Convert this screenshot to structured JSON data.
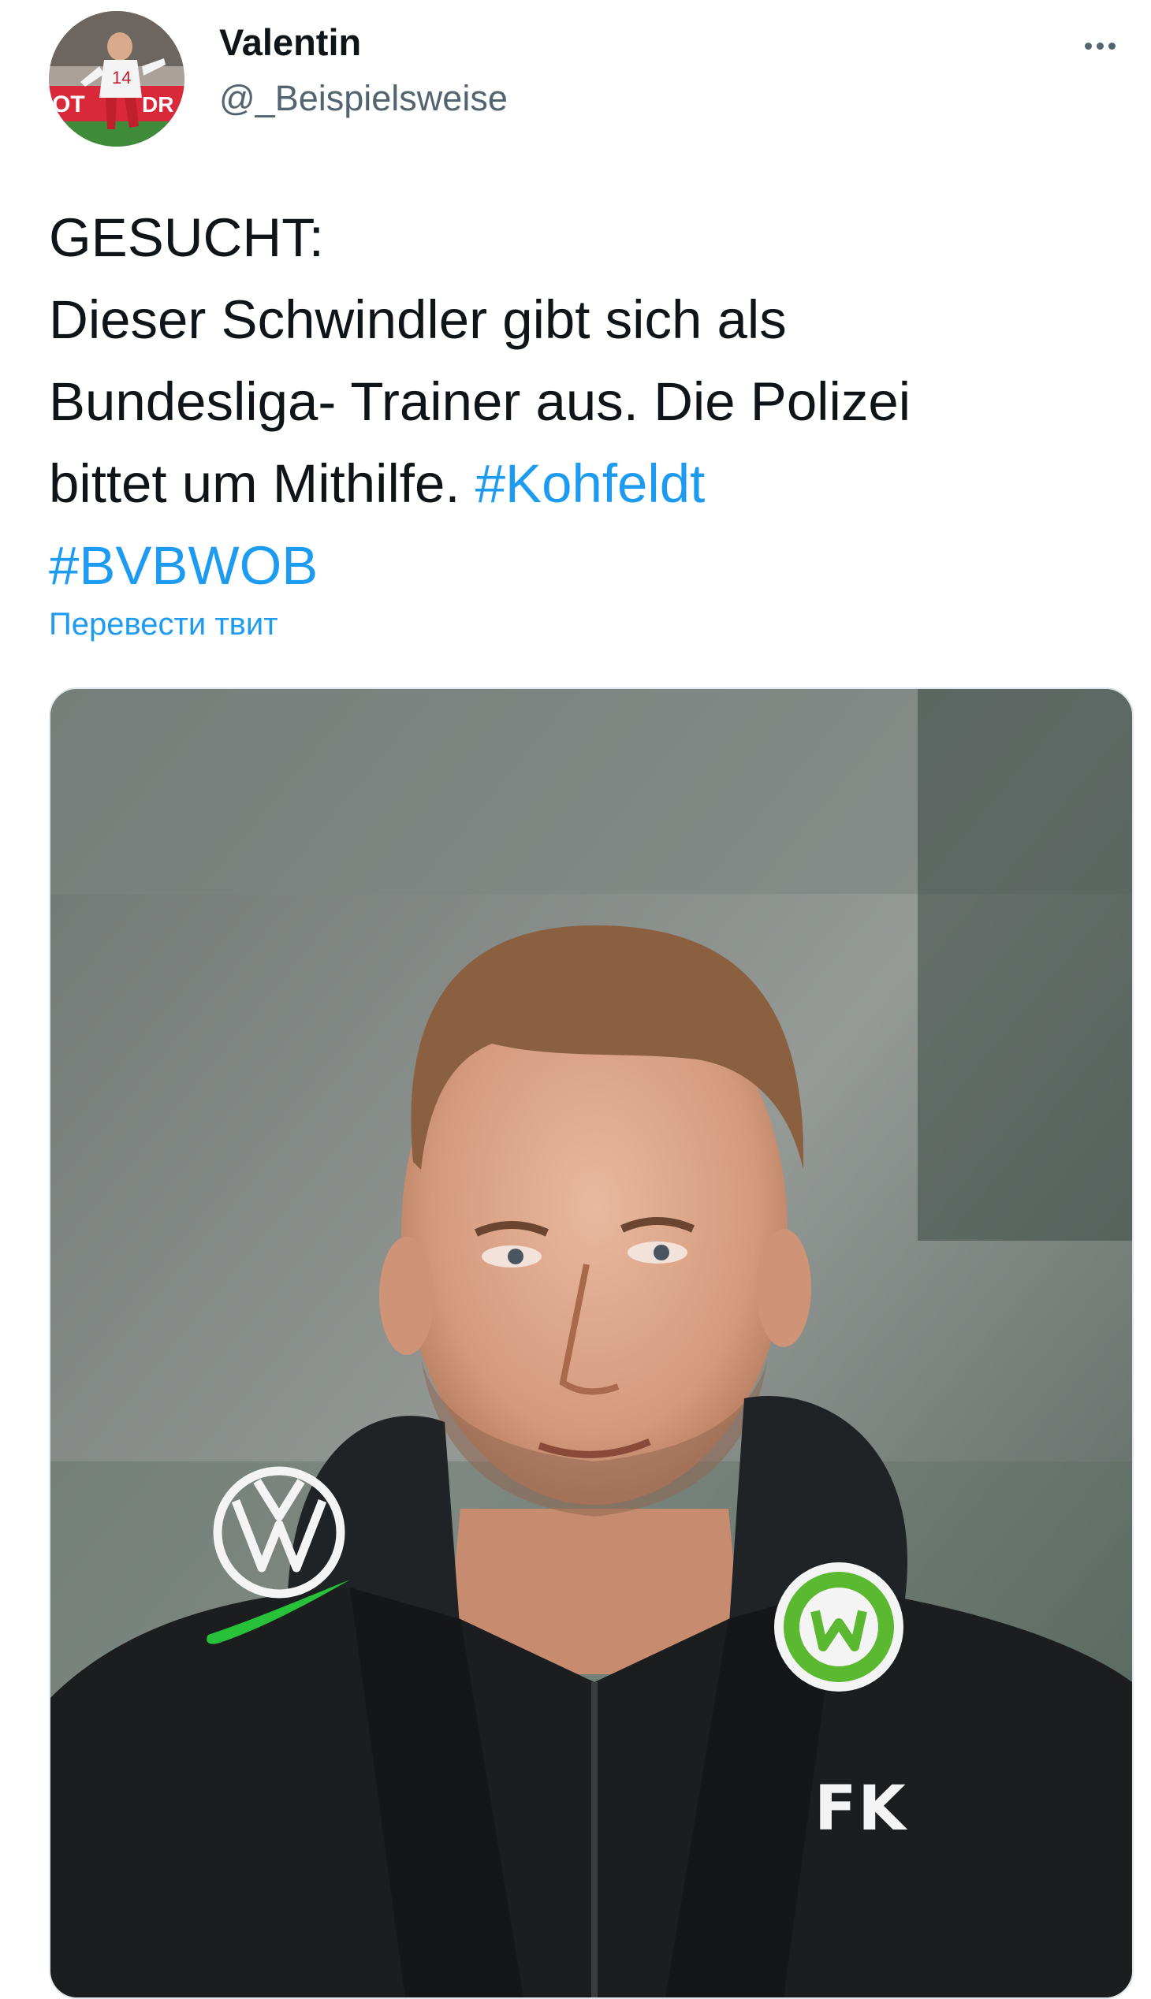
{
  "tweet": {
    "author": {
      "display_name": "Valentin",
      "handle": "@_Beispielsweise",
      "avatar_icon": "footballer-avatar"
    },
    "more_icon": "more-horizontal-icon",
    "text": {
      "line1": "GESUCHT:",
      "line2": "Dieser Schwindler gibt sich als",
      "line3": "Bundesliga- Trainer aus. Die Polizei",
      "line4_text": "bittet um Mithilfe. ",
      "hashtag1": "#Kohfeldt",
      "hashtag2": "#BVBWOB"
    },
    "translate_label": "Перевести твит",
    "photo": {
      "description_icon": "coach-photo",
      "jacket_initials": "FK"
    }
  },
  "colors": {
    "link": "#1d9bf0",
    "text": "#0f1419",
    "secondary": "#536471",
    "jacket": "#1b1d1f",
    "wolfsburg_green": "#5ab831",
    "nike_green": "#27c13a"
  }
}
